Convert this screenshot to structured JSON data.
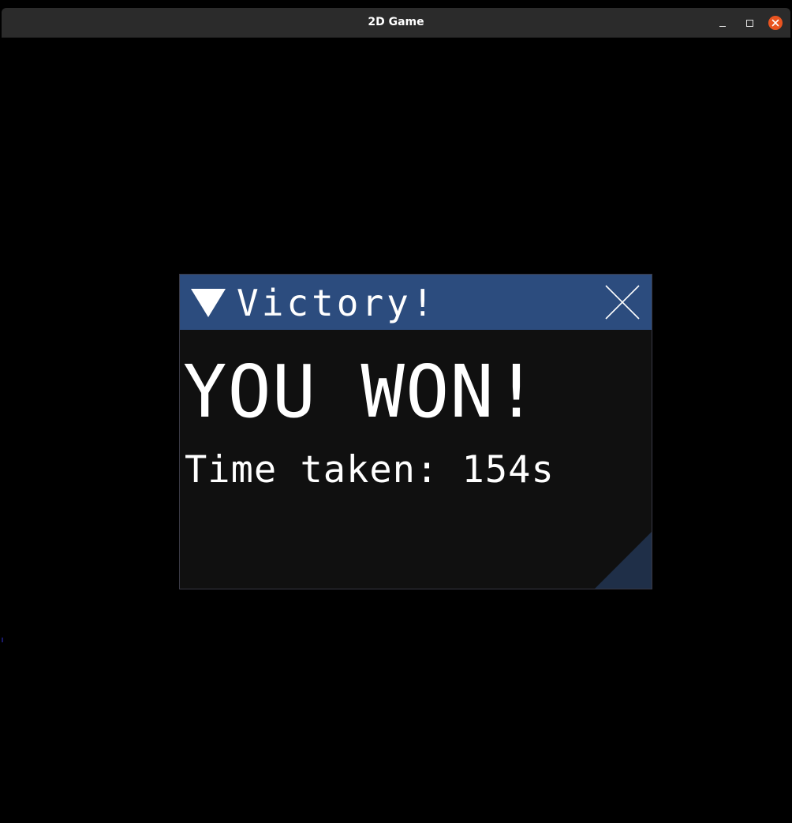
{
  "window": {
    "title": "2D Game",
    "minimize_icon": "minimize-icon",
    "maximize_icon": "maximize-icon",
    "close_icon": "close-icon",
    "close_color": "#e95420"
  },
  "dialog": {
    "title": "Victory!",
    "collapse_icon": "triangle-down-icon",
    "close_icon": "x-close-icon",
    "header_color": "#2c4c7e",
    "headline": "YOU WON!",
    "time_text": "Time taken: 154s"
  }
}
